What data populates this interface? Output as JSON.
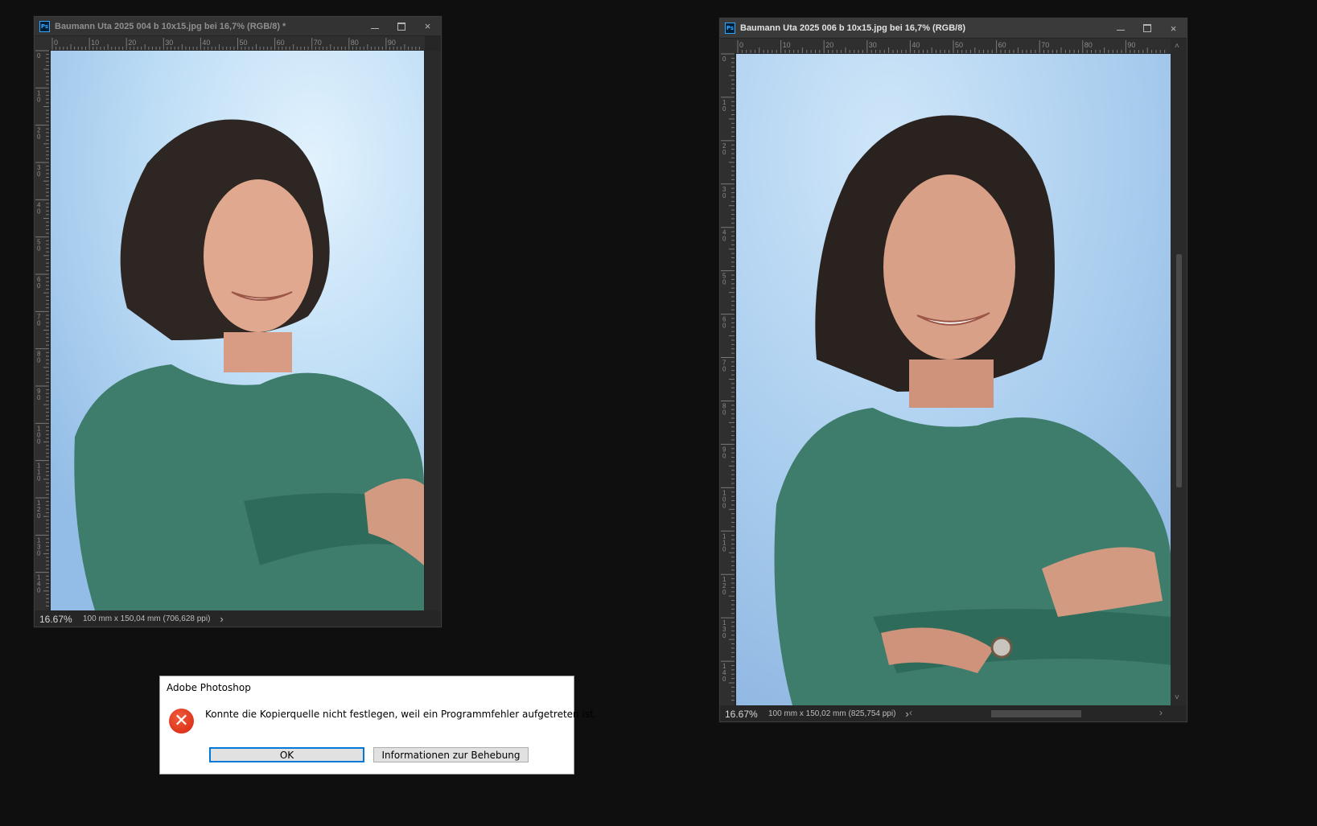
{
  "windows": [
    {
      "title": "Baumann Uta 2025 004  b 10x15.jpg bei 16,7% (RGB/8) *",
      "zoom": "16.67%",
      "doc_info": "100 mm x 150,04 mm (706,628 ppi)",
      "ruler_h": [
        "0",
        "10",
        "20",
        "30",
        "40",
        "50",
        "60",
        "70",
        "80",
        "90"
      ],
      "ruler_v": [
        "0",
        "1\n0",
        "2\n0",
        "3\n0",
        "4\n0",
        "5\n0",
        "6\n0",
        "7\n0",
        "8\n0",
        "9\n0",
        "1\n0\n0",
        "1\n1\n0",
        "1\n2\n0",
        "1\n3\n0",
        "1\n4\n0"
      ]
    },
    {
      "title": "Baumann Uta 2025 006  b 10x15.jpg bei 16,7% (RGB/8)",
      "zoom": "16.67%",
      "doc_info": "100 mm x 150,02 mm (825,754 ppi)",
      "ruler_h": [
        "0",
        "10",
        "20",
        "30",
        "40",
        "50",
        "60",
        "70",
        "80",
        "90"
      ],
      "ruler_v": [
        "0",
        "1\n0",
        "2\n0",
        "3\n0",
        "4\n0",
        "5\n0",
        "6\n0",
        "7\n0",
        "8\n0",
        "9\n0",
        "1\n0\n0",
        "1\n1\n0",
        "1\n2\n0",
        "1\n3\n0",
        "1\n4\n0"
      ]
    }
  ],
  "icons": {
    "ps_logo": "Ps",
    "minimize": "minimize-icon",
    "maximize": "maximize-icon",
    "close": "×",
    "chevron_right": "›",
    "chevron_left": "‹",
    "chevron_up": "˄",
    "chevron_down": "˅"
  },
  "dialog": {
    "title": "Adobe Photoshop",
    "message": "Konnte die Kopierquelle nicht festlegen, weil ein Programmfehler aufgetreten ist.",
    "ok_label": "OK",
    "info_label": "Informationen zur Behebung",
    "icon_glyph": "✕"
  },
  "colors": {
    "app_bg": "#0f0f0f",
    "window_bg": "#262626",
    "backdrop_blue": "#b6d8f3",
    "shirt_green": "#3e7d6c",
    "error_red": "#d4260f",
    "accent_blue": "#0078d7"
  }
}
